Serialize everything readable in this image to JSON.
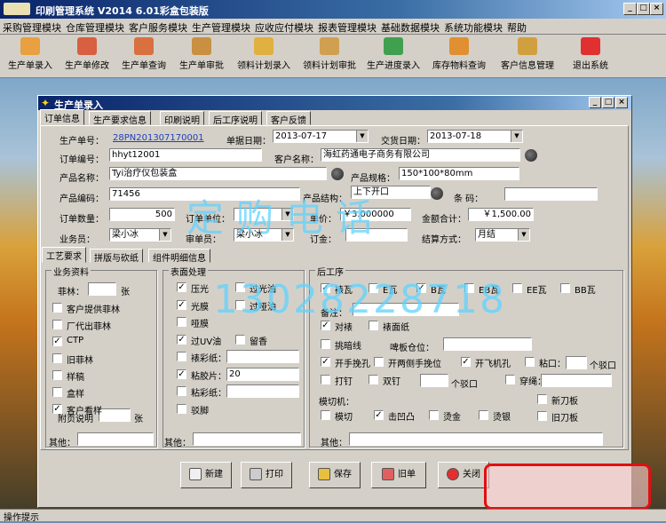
{
  "app": {
    "title": "印刷管理系统  V2014  6.01彩盒包装版"
  },
  "menu": [
    "采购管理模块",
    "仓库管理模块",
    "客户服务模块",
    "生产管理模块",
    "应收应付模块",
    "报表管理模块",
    "基础数据模块",
    "系统功能模块",
    "帮助"
  ],
  "toolbar": [
    {
      "label": "生产单录入",
      "icon": "order-entry-icon",
      "color": "#e8a040"
    },
    {
      "label": "生产单修改",
      "icon": "order-edit-icon",
      "color": "#d86040"
    },
    {
      "label": "生产单查询",
      "icon": "order-query-icon",
      "color": "#d87040"
    },
    {
      "label": "生产单审批",
      "icon": "order-approve-icon",
      "color": "#c89040"
    },
    {
      "label": "领料计划录入",
      "icon": "material-plan-entry-icon",
      "color": "#e0b040"
    },
    {
      "label": "领料计划审批",
      "icon": "material-plan-approve-icon",
      "color": "#d0a050"
    },
    {
      "label": "生产进度录入",
      "icon": "progress-entry-icon",
      "color": "#40a050"
    },
    {
      "label": "库存物料查询",
      "icon": "stock-query-icon",
      "color": "#e09030"
    },
    {
      "label": "客户信息管理",
      "icon": "customer-icon",
      "color": "#d0a040"
    },
    {
      "label": "退出系统",
      "icon": "exit-icon",
      "color": "#e03030"
    }
  ],
  "window": {
    "title": "生产单录入"
  },
  "tabs": [
    "订单信息",
    "生产要求信息",
    "印刷说明",
    "后工序说明",
    "客户反馈"
  ],
  "form": {
    "order_no_label": "生产单号：",
    "order_no": "28PN201307170001",
    "order_date_label": "单据日期：",
    "order_date": "2013-07-17",
    "delivery_date_label": "交货日期：",
    "delivery_date": "2013-07-18",
    "order_code_label": "订单编号：",
    "order_code": "hhyt12001",
    "customer_label": "客户名称：",
    "customer": "海虹药通电子商务有限公司",
    "product_label": "产品名称：",
    "product": "Tyi治疗仪包装盒",
    "spec_label": "产品规格：",
    "spec": "150*100*80mm",
    "product_code_label": "产品编码：",
    "product_code": "71456",
    "structure_label": "产品结构：",
    "structure": "上下开口",
    "barcode_label": "条  码：",
    "barcode": "",
    "qty_label": "订单数量：",
    "qty": "500",
    "unit_label": "订单单位：",
    "unit": "",
    "price_label": "单价：",
    "price": "￥3.000000",
    "amount_label": "金额合计：",
    "amount": "￥1,500.00",
    "salesman_label": "业务员：",
    "salesman": "梁小冰",
    "reviewer_label": "审单员：",
    "reviewer": "梁小冰",
    "deposit_label": "订金：",
    "deposit": "",
    "settle_label": "结算方式：",
    "settle": "月结"
  },
  "subtabs": [
    "工艺要求",
    "拼版与砍纸",
    "组件明细信息"
  ],
  "business": {
    "title": "业务资料",
    "film_label": "菲林：",
    "film_unit": "张",
    "items": [
      {
        "label": "客户提供菲林",
        "checked": false
      },
      {
        "label": "厂代出菲林",
        "checked": false
      },
      {
        "label": "CTP",
        "checked": true
      },
      {
        "label": "旧菲林",
        "checked": false
      },
      {
        "label": "样稿",
        "checked": false
      },
      {
        "label": "盒样",
        "checked": false
      },
      {
        "label": "客户看样",
        "checked": true
      }
    ],
    "attach_label": "附页说明",
    "attach_unit": "张",
    "other_label": "其他："
  },
  "surface": {
    "title": "表面处理",
    "rows": [
      [
        {
          "label": "压光",
          "checked": true
        },
        {
          "label": "过光油",
          "checked": false
        }
      ],
      [
        {
          "label": "光膜",
          "checked": true
        },
        {
          "label": "过哑油",
          "checked": false
        }
      ],
      [
        {
          "label": "哑膜",
          "checked": false
        }
      ],
      [
        {
          "label": "过UV油",
          "checked": true
        },
        {
          "label": "留香",
          "checked": false
        }
      ],
      [
        {
          "label": "裱彩纸：",
          "checked": false
        }
      ],
      [
        {
          "label": "粘胶片：",
          "checked": true,
          "value": "20"
        }
      ],
      [
        {
          "label": "粘彩纸：",
          "checked": false
        }
      ],
      [
        {
          "label": "驳脚",
          "checked": false
        }
      ]
    ],
    "other_label": "其他："
  },
  "post": {
    "title": "后工序",
    "row1": [
      {
        "label": "裱瓦",
        "checked": true
      },
      {
        "label": "E瓦",
        "checked": false
      },
      {
        "label": "B瓦",
        "checked": true
      },
      {
        "label": "EB瓦",
        "checked": false
      },
      {
        "label": "EE瓦",
        "checked": false
      },
      {
        "label": "BB瓦",
        "checked": false
      }
    ],
    "note_label": "备注：",
    "cut": {
      "label": "对裱",
      "checked": true
    },
    "face": {
      "label": "裱面纸",
      "checked": false
    },
    "dark": {
      "label": "挑暗线",
      "checked": false
    },
    "beer_label": "啤板仓位：",
    "row5": [
      {
        "label": "开手挽孔",
        "checked": true
      },
      {
        "label": "开两侧手挽位",
        "checked": false
      },
      {
        "label": "开飞机孔",
        "checked": true
      },
      {
        "label": "粘口：",
        "checked": false
      }
    ],
    "glue_unit": "个驳口",
    "row6": [
      {
        "label": "打钉",
        "checked": false
      },
      {
        "label": "双钉",
        "checked": false
      }
    ],
    "nail_unit": "个驳口",
    "rope": {
      "label": "穿绳：",
      "checked": false
    },
    "die_label": "模切机：",
    "new_die": {
      "label": "新刀板",
      "checked": false
    },
    "row7": [
      {
        "label": "模切",
        "checked": false
      },
      {
        "label": "击凹凸",
        "checked": true
      },
      {
        "label": "烫金",
        "checked": false
      },
      {
        "label": "烫银",
        "checked": false
      }
    ],
    "old_die": {
      "label": "旧刀板",
      "checked": false
    },
    "other_label": "其他："
  },
  "buttons": [
    "新建",
    "打印",
    "保存",
    "旧单",
    "关闭"
  ],
  "status": "操作提示",
  "watermark": "定购电话",
  "phone": "13028228718"
}
